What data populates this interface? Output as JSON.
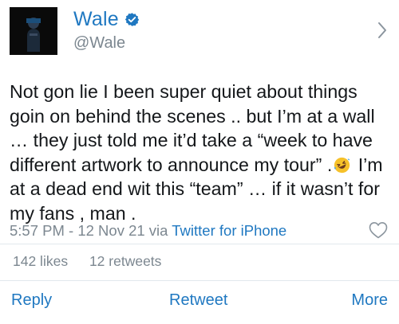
{
  "user": {
    "display_name": "Wale",
    "handle": "@Wale"
  },
  "tweet": {
    "text_before_emoji": "Not gon lie I been super quiet about things goin on behind the scenes .. but I’m at a wall … they just told me it’d take a “week to have different artwork to announce my tour” .",
    "text_after_emoji": " I’m at a dead end wit this “team” … if it wasn’t for my fans , man ."
  },
  "meta": {
    "timestamp": "5:57 PM - 12 Nov 21 via ",
    "source": "Twitter for iPhone"
  },
  "stats": {
    "likes": "142 likes",
    "retweets": "12 retweets"
  },
  "actions": {
    "reply": "Reply",
    "retweet": "Retweet",
    "more": "More"
  },
  "colors": {
    "accent": "#1f78c1",
    "secondary_text": "#7c8790",
    "divider": "#e1e8ed"
  },
  "icons": {
    "verified": "verified-badge-icon",
    "chevron": "chevron-right-icon",
    "like": "heart-outline-icon",
    "emoji": "rolling-on-floor-laughing-emoji"
  }
}
